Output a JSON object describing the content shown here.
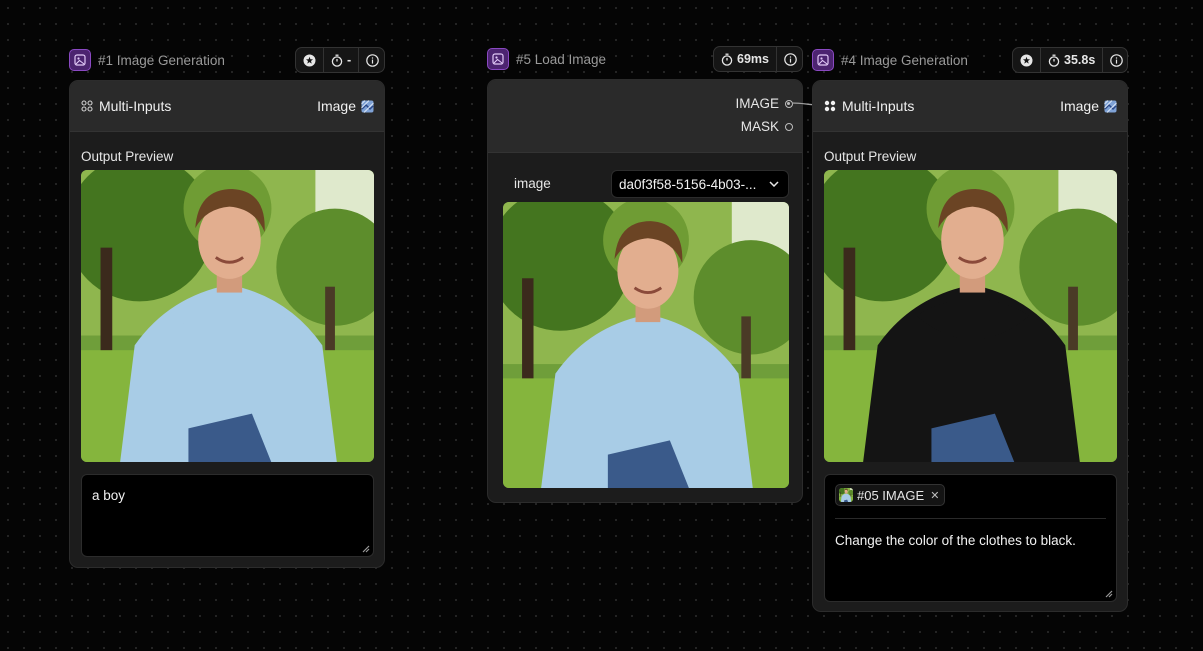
{
  "nodes": [
    {
      "title": "#1 Image Generation",
      "stats": {
        "time": "-"
      },
      "multi_inputs_label": "Multi-Inputs",
      "image_label": "Image",
      "preview_label": "Output Preview",
      "prompt": "a boy",
      "hoodie_color": "#a8cce6"
    },
    {
      "title": "#5 Load Image",
      "stats": {
        "time": "69ms"
      },
      "outputs": {
        "image": "IMAGE",
        "mask": "MASK"
      },
      "field_label": "image",
      "field_value": "da0f3f58-5156-4b03-...",
      "hoodie_color": "#a8cce6"
    },
    {
      "title": "#4 Image Generation",
      "stats": {
        "time": "35.8s"
      },
      "multi_inputs_label": "Multi-Inputs",
      "image_label": "Image",
      "preview_label": "Output Preview",
      "chip_label": "#05 IMAGE",
      "prompt": "Change the color of the clothes to black.",
      "hoodie_color": "#141414"
    }
  ],
  "colors": {
    "accent": "#8a49c2",
    "canvas": "#050505"
  }
}
